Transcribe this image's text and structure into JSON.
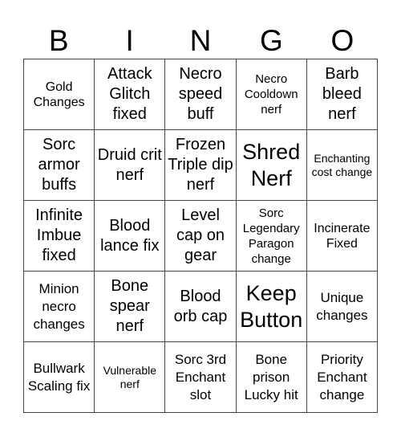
{
  "header": [
    "B",
    "I",
    "N",
    "G",
    "O"
  ],
  "cells": [
    "Gold Changes",
    "Attack Glitch fixed",
    "Necro speed buff",
    "Necro Cooldown nerf",
    "Barb bleed nerf",
    "Sorc armor buffs",
    "Druid crit nerf",
    "Frozen Triple dip nerf",
    "Shred Nerf",
    "Enchanting cost change",
    "Infinite Imbue fixed",
    "Blood lance fix",
    "Level cap on gear",
    "Sorc Legendary Paragon change",
    "Incinerate Fixed",
    "Minion necro changes",
    "Bone spear nerf",
    "Blood orb cap",
    "Keep Button",
    "Unique changes",
    "Bullwark Scaling fix",
    "Vulnerable nerf",
    "Sorc 3rd Enchant slot",
    "Bone prison Lucky hit",
    "Priority Enchant change"
  ]
}
